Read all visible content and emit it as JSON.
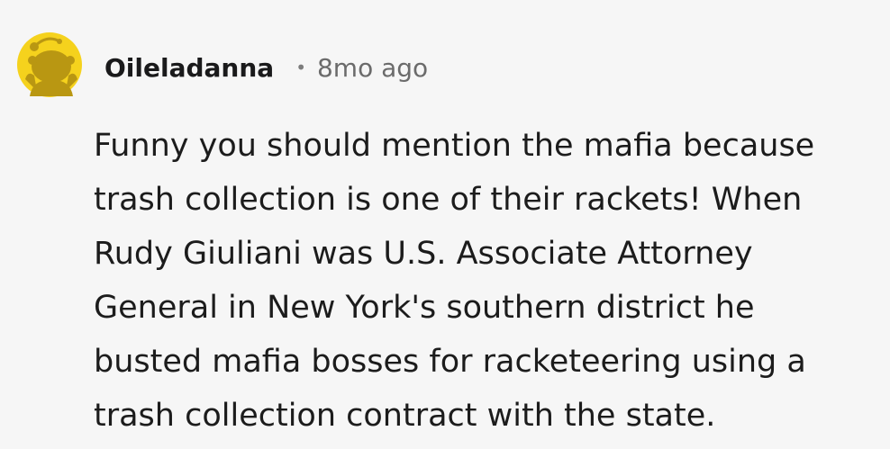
{
  "comment": {
    "author": "Oileladanna",
    "separator": "•",
    "timestamp": "8mo ago",
    "avatar_icon": "snoo-avatar-icon",
    "avatar_color": "#f5d21d",
    "body_lines": [
      "Funny you should mention the mafia because",
      "trash collection is one of their rackets! When",
      "Rudy Giuliani was U.S. Associate Attorney",
      "General in New York's southern district he",
      "busted mafia bosses for racketeering using a",
      "trash collection contract with the state."
    ]
  }
}
